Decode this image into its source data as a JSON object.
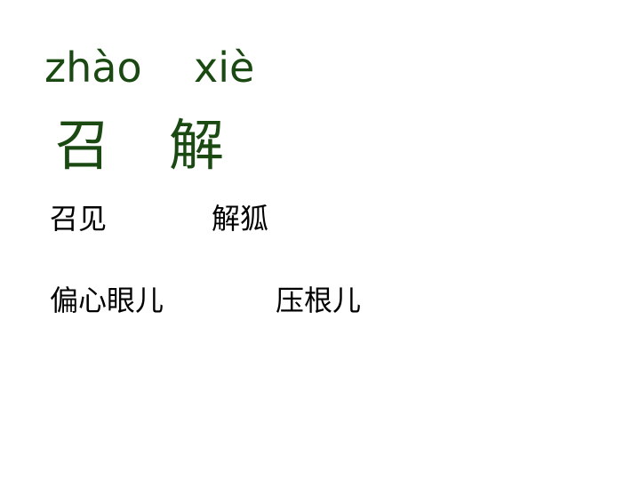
{
  "characters": [
    {
      "pinyin": "zhào",
      "hanzi": "召"
    },
    {
      "pinyin": "xiè",
      "hanzi": "解"
    }
  ],
  "words": [
    "召见",
    "解狐",
    "偏心眼儿",
    "压根儿"
  ],
  "colors": {
    "character_text": "#1a4a12",
    "word_text": "#000000",
    "background": "#ffffff"
  }
}
